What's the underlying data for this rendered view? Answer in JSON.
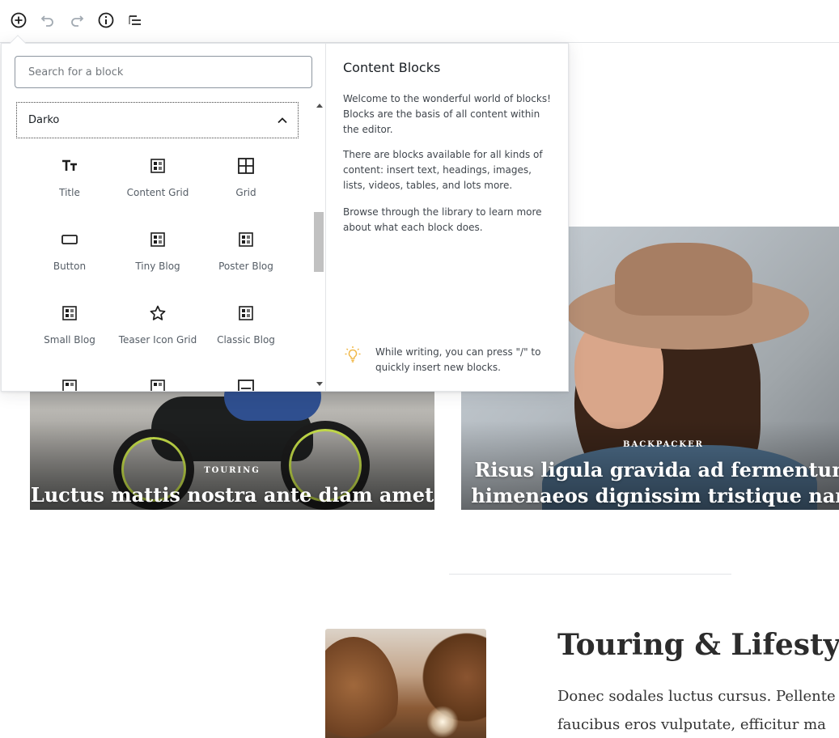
{
  "toolbar": {
    "add_icon": "plus-circle-icon",
    "undo_icon": "undo-icon",
    "redo_icon": "redo-icon",
    "info_icon": "info-icon",
    "outline_icon": "list-outline-icon"
  },
  "inserter": {
    "search_placeholder": "Search for a block",
    "panel_title": "Darko",
    "blocks": [
      {
        "label": "Title",
        "icon": "text-icon"
      },
      {
        "label": "Content Grid",
        "icon": "layout-icon"
      },
      {
        "label": "Grid",
        "icon": "grid-icon"
      },
      {
        "label": "Button",
        "icon": "button-icon"
      },
      {
        "label": "Tiny Blog",
        "icon": "layout-icon"
      },
      {
        "label": "Poster Blog",
        "icon": "layout-icon"
      },
      {
        "label": "Small Blog",
        "icon": "layout-icon"
      },
      {
        "label": "Teaser Icon Grid",
        "icon": "star-icon"
      },
      {
        "label": "Classic Blog",
        "icon": "layout-icon"
      }
    ],
    "help": {
      "title": "Content Blocks",
      "paragraphs": [
        "Welcome to the wonderful world of blocks! Blocks are the basis of all content within the editor.",
        "There are blocks available for all kinds of content: insert text, headings, images, lists, videos, tables, and lots more.",
        "Browse through the library to learn more about what each block does."
      ],
      "tip": "While writing, you can press \"/\" to quickly insert new blocks."
    }
  },
  "content": {
    "card_left": {
      "category": "TOURING",
      "title": "Luctus mattis nostra ante diam amet"
    },
    "card_right": {
      "category": "BACKPACKER",
      "title_line1": "Risus ligula gravida ad fermentum",
      "title_line2": "himenaeos dignissim tristique nam"
    },
    "post_heading": "Touring & Lifestyle",
    "post_body_line1": "Donec sodales luctus cursus. Pellente",
    "post_body_line2": "faucibus eros vulputate, efficitur ma"
  },
  "colors": {
    "accent_tip": "#f0b849",
    "border": "#e2e4e7",
    "icon": "#1e1e1e"
  }
}
